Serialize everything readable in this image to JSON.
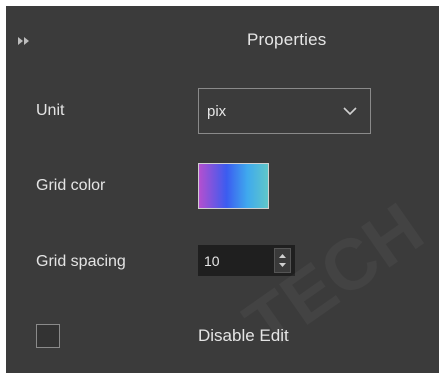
{
  "panel": {
    "title": "Properties",
    "collapse_icon": "double-chevron-right-icon"
  },
  "unit": {
    "label": "Unit",
    "value": "pix",
    "dropdown_icon": "chevron-down-icon"
  },
  "grid_color": {
    "label": "Grid color",
    "gradient": [
      "#b44fcf",
      "#3b5cf0",
      "#3fa9ee",
      "#5fc7c9"
    ]
  },
  "grid_spacing": {
    "label": "Grid spacing",
    "value": "10"
  },
  "disable_edit": {
    "label": "Disable Edit",
    "checked": false
  },
  "colors": {
    "panel_bg": "#3b3b3b",
    "text": "#e6e6e6",
    "input_bg": "#1f1f1f"
  }
}
